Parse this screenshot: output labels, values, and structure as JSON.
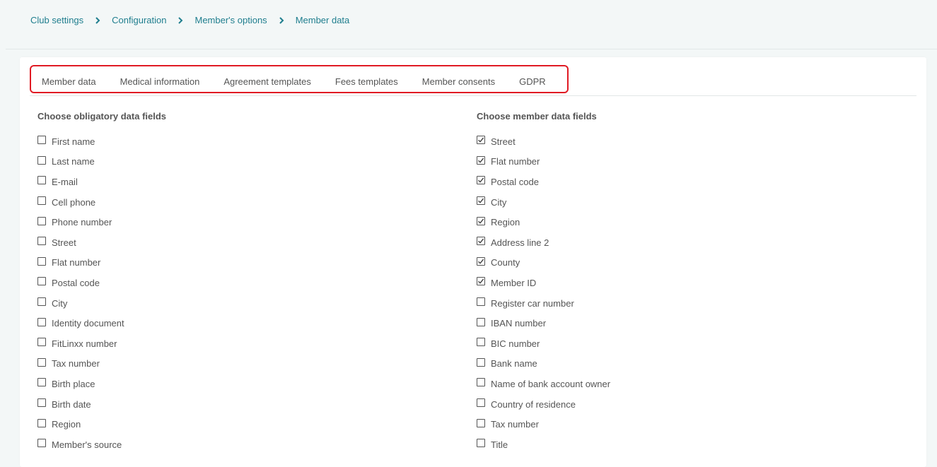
{
  "breadcrumb": {
    "items": [
      "Club settings",
      "Configuration",
      "Member's options",
      "Member data"
    ]
  },
  "tabs": [
    {
      "label": "Member data"
    },
    {
      "label": "Medical information"
    },
    {
      "label": "Agreement templates"
    },
    {
      "label": "Fees templates"
    },
    {
      "label": "Member consents"
    },
    {
      "label": "GDPR"
    }
  ],
  "obligatory": {
    "title": "Choose obligatory data fields",
    "items": [
      {
        "label": "First name",
        "checked": false
      },
      {
        "label": "Last name",
        "checked": false
      },
      {
        "label": "E-mail",
        "checked": false
      },
      {
        "label": "Cell phone",
        "checked": false
      },
      {
        "label": "Phone number",
        "checked": false
      },
      {
        "label": "Street",
        "checked": false
      },
      {
        "label": "Flat number",
        "checked": false
      },
      {
        "label": "Postal code",
        "checked": false
      },
      {
        "label": "City",
        "checked": false
      },
      {
        "label": "Identity document",
        "checked": false
      },
      {
        "label": "FitLinxx number",
        "checked": false
      },
      {
        "label": "Tax number",
        "checked": false
      },
      {
        "label": "Birth place",
        "checked": false
      },
      {
        "label": "Birth date",
        "checked": false
      },
      {
        "label": "Region",
        "checked": false
      },
      {
        "label": "Member's source",
        "checked": false
      }
    ]
  },
  "member_fields": {
    "title": "Choose member data fields",
    "items": [
      {
        "label": "Street",
        "checked": true
      },
      {
        "label": "Flat number",
        "checked": true
      },
      {
        "label": "Postal code",
        "checked": true
      },
      {
        "label": "City",
        "checked": true
      },
      {
        "label": "Region",
        "checked": true
      },
      {
        "label": "Address line 2",
        "checked": true
      },
      {
        "label": "County",
        "checked": true
      },
      {
        "label": "Member ID",
        "checked": true
      },
      {
        "label": "Register car number",
        "checked": false
      },
      {
        "label": "IBAN number",
        "checked": false
      },
      {
        "label": "BIC number",
        "checked": false
      },
      {
        "label": "Bank name",
        "checked": false
      },
      {
        "label": "Name of bank account owner",
        "checked": false
      },
      {
        "label": "Country of residence",
        "checked": false
      },
      {
        "label": "Tax number",
        "checked": false
      },
      {
        "label": "Title",
        "checked": false
      }
    ]
  }
}
